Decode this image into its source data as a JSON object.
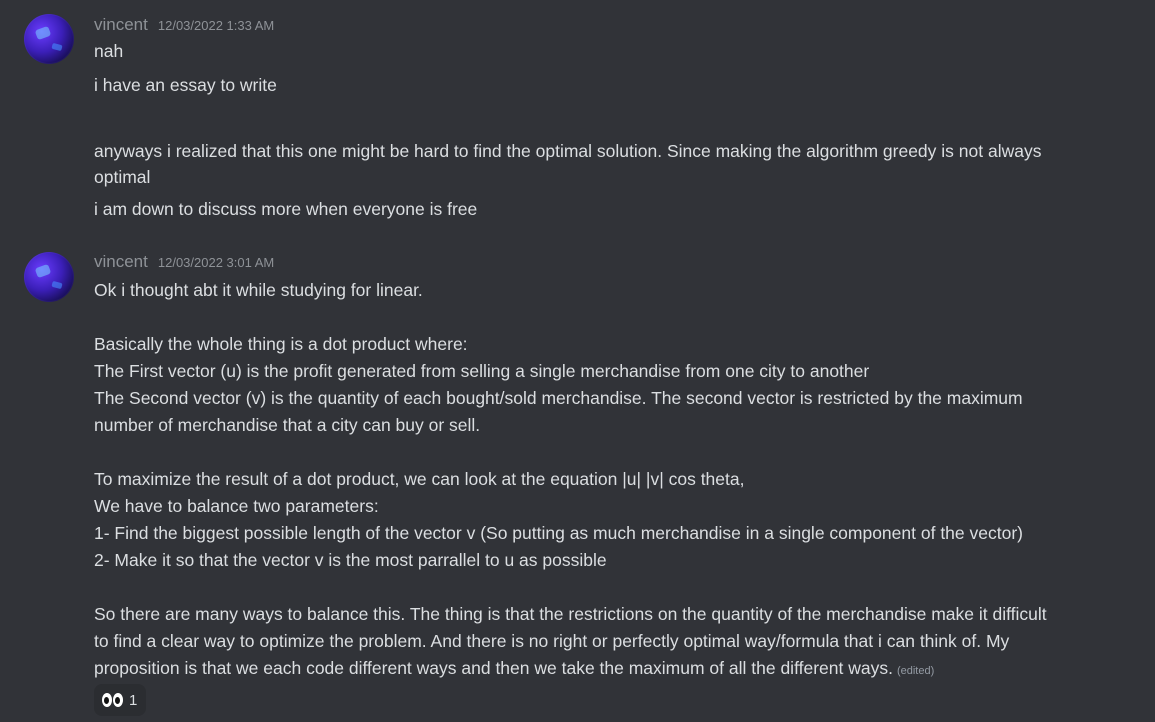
{
  "messages": [
    {
      "author": "vincent",
      "timestamp": "12/03/2022 1:33 AM",
      "lines": [
        "nah",
        "i have an essay to write",
        "anyways i realized that this one might be hard to find the optimal solution. Since making the algorithm greedy is not always",
        "optimal",
        "i am down to discuss more when everyone is free"
      ]
    },
    {
      "author": "vincent",
      "timestamp": "12/03/2022 3:01 AM",
      "lines": [
        "Ok i thought abt it while studying for linear.",
        "Basically the whole thing is a dot product where:",
        "The First vector (u) is the profit generated from selling a single merchandise from one city to another",
        "The Second vector (v) is the quantity of each bought/sold merchandise. The second vector is restricted by the maximum",
        "number of merchandise that a city can buy or sell.",
        "To maximize the result of a dot product, we can look at the equation |u| |v| cos theta,",
        "We have to balance two parameters:",
        "1- Find the biggest possible length of the vector v (So putting as much merchandise in a single component of the vector)",
        "2- Make it so that the vector v is the most parrallel to u as possible",
        "So there are many ways to balance this. The thing is that the restrictions on the quantity of the merchandise make it difficult",
        "to find a clear way to optimize the problem. And there is no right or perfectly optimal way/formula that i can think of. My",
        "proposition is that we each code different ways and then we take the maximum of all the different ways."
      ],
      "edited_label": "(edited)",
      "reactions": [
        {
          "emoji": "eyes-icon",
          "count": "1"
        }
      ]
    }
  ],
  "colors": {
    "background": "#313338",
    "text": "#dbdee1",
    "muted": "#8e9297",
    "reaction_bg": "#2b2d31"
  }
}
